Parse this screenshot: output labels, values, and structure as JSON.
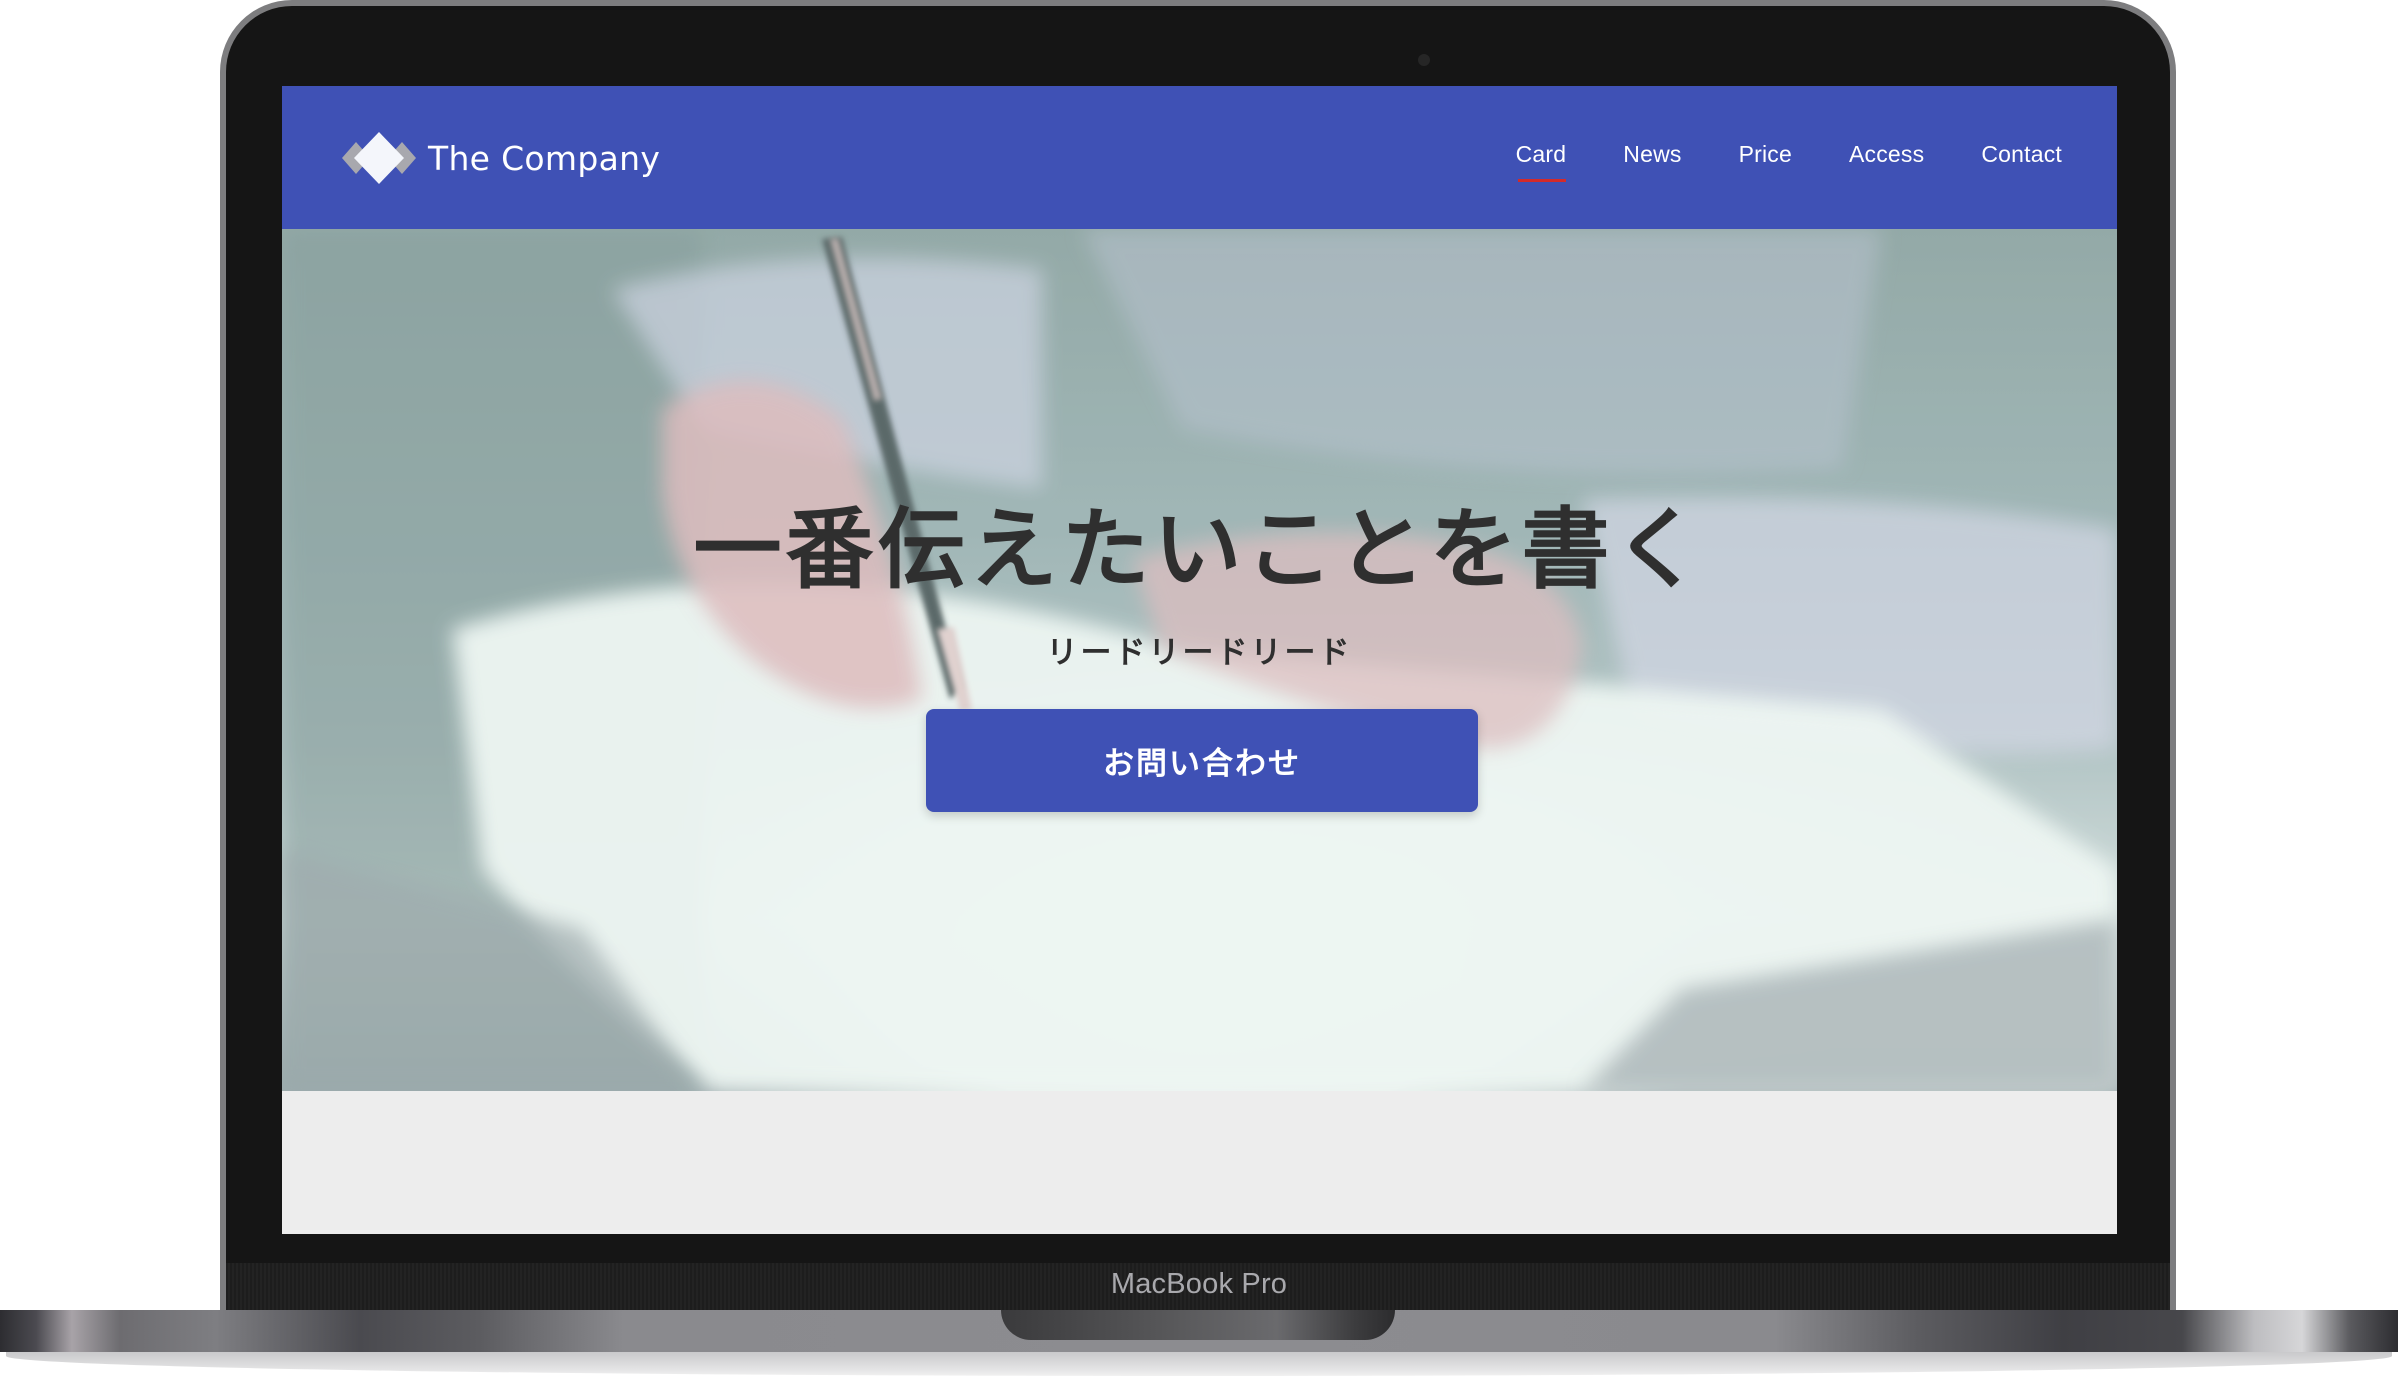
{
  "device": {
    "label": "MacBook Pro"
  },
  "header": {
    "brand_name": "The Company",
    "logo_icon": "diamond-logo-icon",
    "nav": [
      {
        "label": "Card",
        "active": true
      },
      {
        "label": "News",
        "active": false
      },
      {
        "label": "Price",
        "active": false
      },
      {
        "label": "Access",
        "active": false
      },
      {
        "label": "Contact",
        "active": false
      }
    ]
  },
  "hero": {
    "title": "一番伝えたいことを書く",
    "lead": "リードリードリード",
    "cta_label": "お問い合わせ",
    "background_image": "hand-writing-with-pen-on-paper"
  },
  "colors": {
    "primary": "#3f51b5",
    "nav_active_underline": "#d42a2a",
    "text_dark": "#2f2f2f",
    "section_bg": "#ededed"
  }
}
